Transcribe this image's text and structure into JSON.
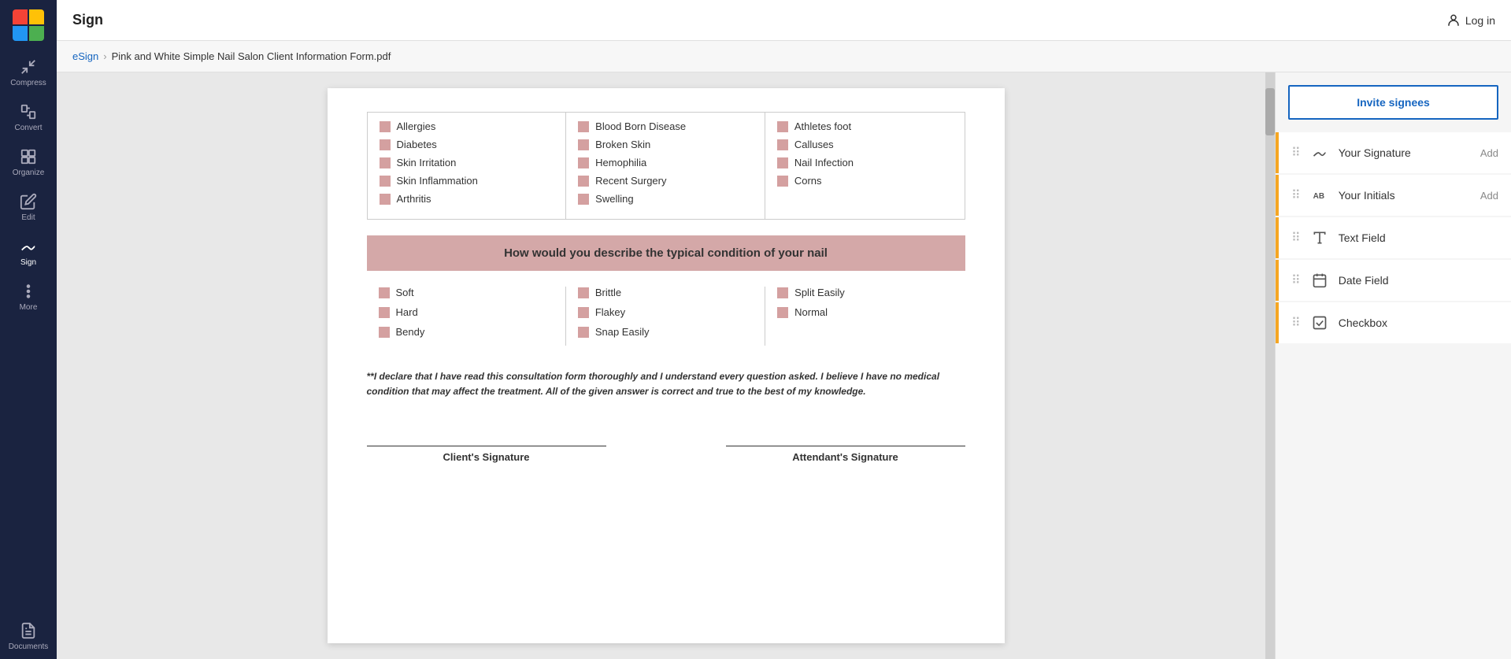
{
  "app": {
    "title": "Sign",
    "login_label": "Log in"
  },
  "breadcrumb": {
    "link": "eSign",
    "separator": "›",
    "current": "Pink and White Simple Nail Salon Client Information Form.pdf"
  },
  "sidebar": {
    "items": [
      {
        "id": "compress",
        "label": "Compress",
        "icon": "compress"
      },
      {
        "id": "convert",
        "label": "Convert",
        "icon": "convert"
      },
      {
        "id": "organize",
        "label": "Organize",
        "icon": "organize"
      },
      {
        "id": "edit",
        "label": "Edit",
        "icon": "edit"
      },
      {
        "id": "sign",
        "label": "Sign",
        "icon": "sign",
        "active": true
      },
      {
        "id": "more",
        "label": "More",
        "icon": "more"
      },
      {
        "id": "documents",
        "label": "Documents",
        "icon": "documents"
      }
    ]
  },
  "document": {
    "conditions": {
      "col1": [
        "Allergies",
        "Diabetes",
        "Skin Irritation",
        "Skin Inflammation",
        "Arthritis"
      ],
      "col2": [
        "Blood Born Disease",
        "Broken Skin",
        "Hemophilia",
        "Recent Surgery",
        "Swelling"
      ],
      "col3": [
        "Athletes foot",
        "Calluses",
        "Nail Infection",
        "Corns"
      ]
    },
    "nail_section": {
      "header": "How would you describe the typical condition of your nail",
      "col1": [
        "Soft",
        "Hard",
        "Bendy"
      ],
      "col2": [
        "Brittle",
        "Flakey",
        "Snap Easily"
      ],
      "col3": [
        "Split Easily",
        "Normal"
      ]
    },
    "declaration": "**I declare that I have read this consultation form thoroughly and I understand every question asked. I believe I have no medical condition that may affect the treatment. All of the given answer is correct and true to the best of my knowledge.",
    "signatures": {
      "client": "Client's Signature",
      "attendant": "Attendant's Signature"
    }
  },
  "right_panel": {
    "invite_btn": "Invite signees",
    "fields": [
      {
        "id": "signature",
        "label": "Your Signature",
        "icon": "pen",
        "add_label": "Add"
      },
      {
        "id": "initials",
        "label": "Your Initials",
        "icon": "ab",
        "add_label": "Add"
      },
      {
        "id": "text",
        "label": "Text Field",
        "icon": "text",
        "add_label": ""
      },
      {
        "id": "date",
        "label": "Date Field",
        "icon": "calendar",
        "add_label": ""
      },
      {
        "id": "checkbox",
        "label": "Checkbox",
        "icon": "checkbox",
        "add_label": ""
      }
    ]
  }
}
